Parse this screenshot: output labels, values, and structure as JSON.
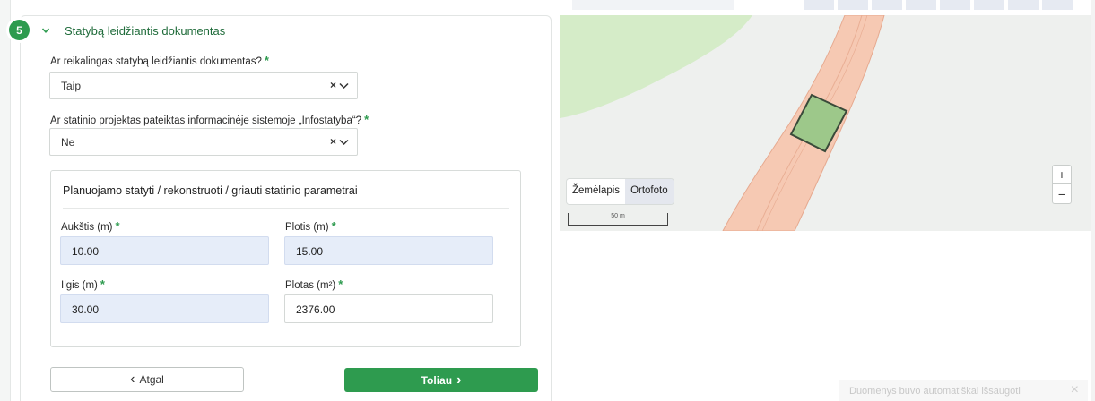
{
  "section": {
    "step_number": "5",
    "title": "Statybą leidžiantis dokumentas"
  },
  "questions": [
    {
      "label": "Ar reikalingas statybą leidžiantis dokumentas?",
      "required_mark": "*",
      "value": "Taip",
      "clear_glyph": "×"
    },
    {
      "label": "Ar statinio projektas pateiktas informacinėje sistemoje „Infostatyba“?",
      "required_mark": "*",
      "value": "Ne",
      "clear_glyph": "×"
    }
  ],
  "params": {
    "title": "Planuojamo statyti / rekonstruoti / griauti statinio parametrai",
    "fields": {
      "height": {
        "label": "Aukštis (m)",
        "required_mark": "*",
        "value": "10.00"
      },
      "width": {
        "label": "Plotis (m)",
        "required_mark": "*",
        "value": "15.00"
      },
      "length": {
        "label": "Ilgis (m)",
        "required_mark": "*",
        "value": "30.00"
      },
      "area": {
        "label": "Plotas (m²)",
        "required_mark": "*",
        "value": "2376.00"
      }
    }
  },
  "nav": {
    "back_label": "Atgal",
    "back_glyph": "‹",
    "next_label": "Toliau",
    "next_glyph": "›"
  },
  "map": {
    "types": [
      "Žemėlapis",
      "Ortofoto"
    ],
    "selected_type": "Žemėlapis",
    "scale_label": "50 m",
    "zoom_in": "+",
    "zoom_out": "−"
  },
  "toast": {
    "message": "Duomenys buvo automatiškai išsaugoti",
    "close_glyph": "×"
  },
  "colors": {
    "primary_green": "#2e9b4f",
    "filled_input": "#e6edf9",
    "map_road": "#f6c9b3",
    "map_park": "#d5ecc8",
    "map_parcel": "#9dc88a"
  }
}
